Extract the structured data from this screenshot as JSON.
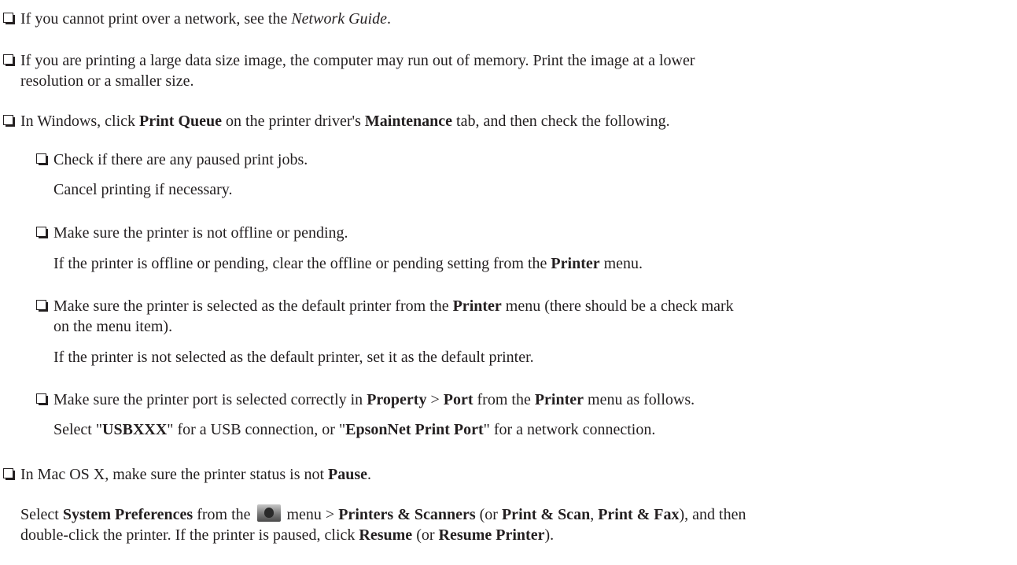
{
  "items": {
    "b1": {
      "pre": "If you cannot print over a network, see the ",
      "italic": "Network Guide",
      "post": "."
    },
    "b2": {
      "line1": "If you are printing a large data size image, the computer may run out of memory. Print the image at a lower",
      "line2": "resolution or a smaller size."
    },
    "b3": {
      "pre": "In Windows, click ",
      "bold1": "Print Queue",
      "mid": " on the printer driver's ",
      "bold2": "Maintenance",
      "post": " tab, and then check the following."
    },
    "s1": {
      "text": "Check if there are any paused print jobs.",
      "note": "Cancel printing if necessary."
    },
    "s2": {
      "text": "Make sure the printer is not offline or pending.",
      "note_pre": "If the printer is offline or pending, clear the offline or pending setting from the ",
      "note_bold": "Printer",
      "note_post": " menu."
    },
    "s3": {
      "pre": "Make sure the printer is selected as the default printer from the ",
      "bold": "Printer",
      "post": " menu (there should be a check mark",
      "line2": "on the menu item).",
      "note": "If the printer is not selected as the default printer, set it as the default printer."
    },
    "s4": {
      "pre": "Make sure the printer port is selected correctly in ",
      "bold1": "Property",
      "sep": " > ",
      "bold2": "Port",
      "mid": " from the ",
      "bold3": "Printer",
      "post": " menu as follows.",
      "note_pre": "Select \"",
      "note_bold1": "USBXXX",
      "note_mid": "\" for a USB connection, or \"",
      "note_bold2": "EpsonNet Print Port",
      "note_post": "\" for a network connection."
    },
    "b4": {
      "pre": "In Mac OS X, make sure the printer status is not ",
      "bold": "Pause",
      "post": "."
    },
    "p1": {
      "pre": "Select ",
      "bold1": "System Preferences",
      "mid1": " from the ",
      "icon": "apple-menu-icon",
      "mid2": " menu > ",
      "bold2": "Printers & Scanners",
      "mid3": " (or ",
      "bold3": "Print & Scan",
      "mid4": ", ",
      "bold4": "Print & Fax",
      "post1": "), and then",
      "line2_pre": "double-click the printer. If the printer is paused, click ",
      "bold5": "Resume",
      "line2_mid": " (or ",
      "bold6": "Resume Printer",
      "line2_post": ")."
    }
  }
}
